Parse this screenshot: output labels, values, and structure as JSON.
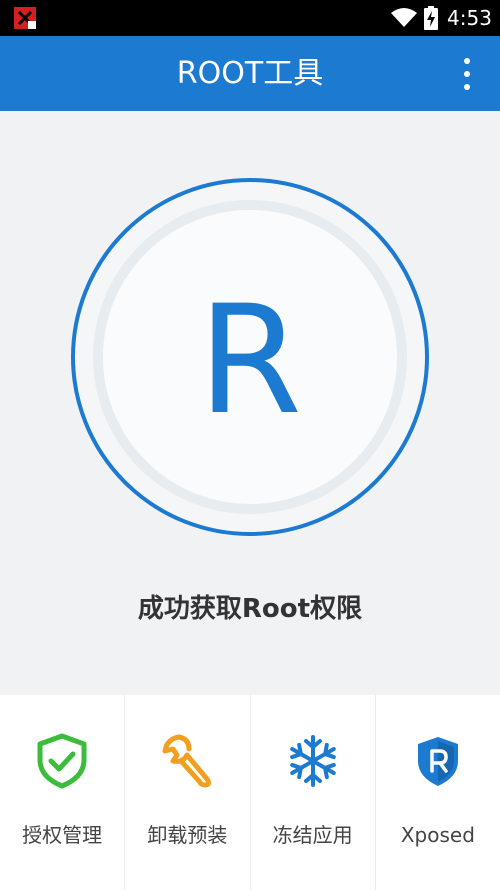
{
  "status_bar": {
    "time": "4:53",
    "icons": [
      "notification-error-icon",
      "wifi-icon",
      "battery-charging-icon"
    ]
  },
  "app_bar": {
    "title": "ROOT工具",
    "menu_icon": "overflow-menu-icon"
  },
  "main": {
    "logo_letter": "R",
    "status_text": "成功获取Root权限"
  },
  "tools": [
    {
      "label": "授权管理",
      "icon": "shield-check-icon"
    },
    {
      "label": "卸载预装",
      "icon": "wrench-icon"
    },
    {
      "label": "冻结应用",
      "icon": "snowflake-icon"
    },
    {
      "label": "Xposed",
      "icon": "xposed-shield-icon"
    }
  ],
  "colors": {
    "primary": "#1c7ad1",
    "background": "#f1f2f4",
    "shield_green": "#3bbd3b",
    "wrench_orange": "#f0a020",
    "snowflake_blue": "#1c7ad1"
  }
}
